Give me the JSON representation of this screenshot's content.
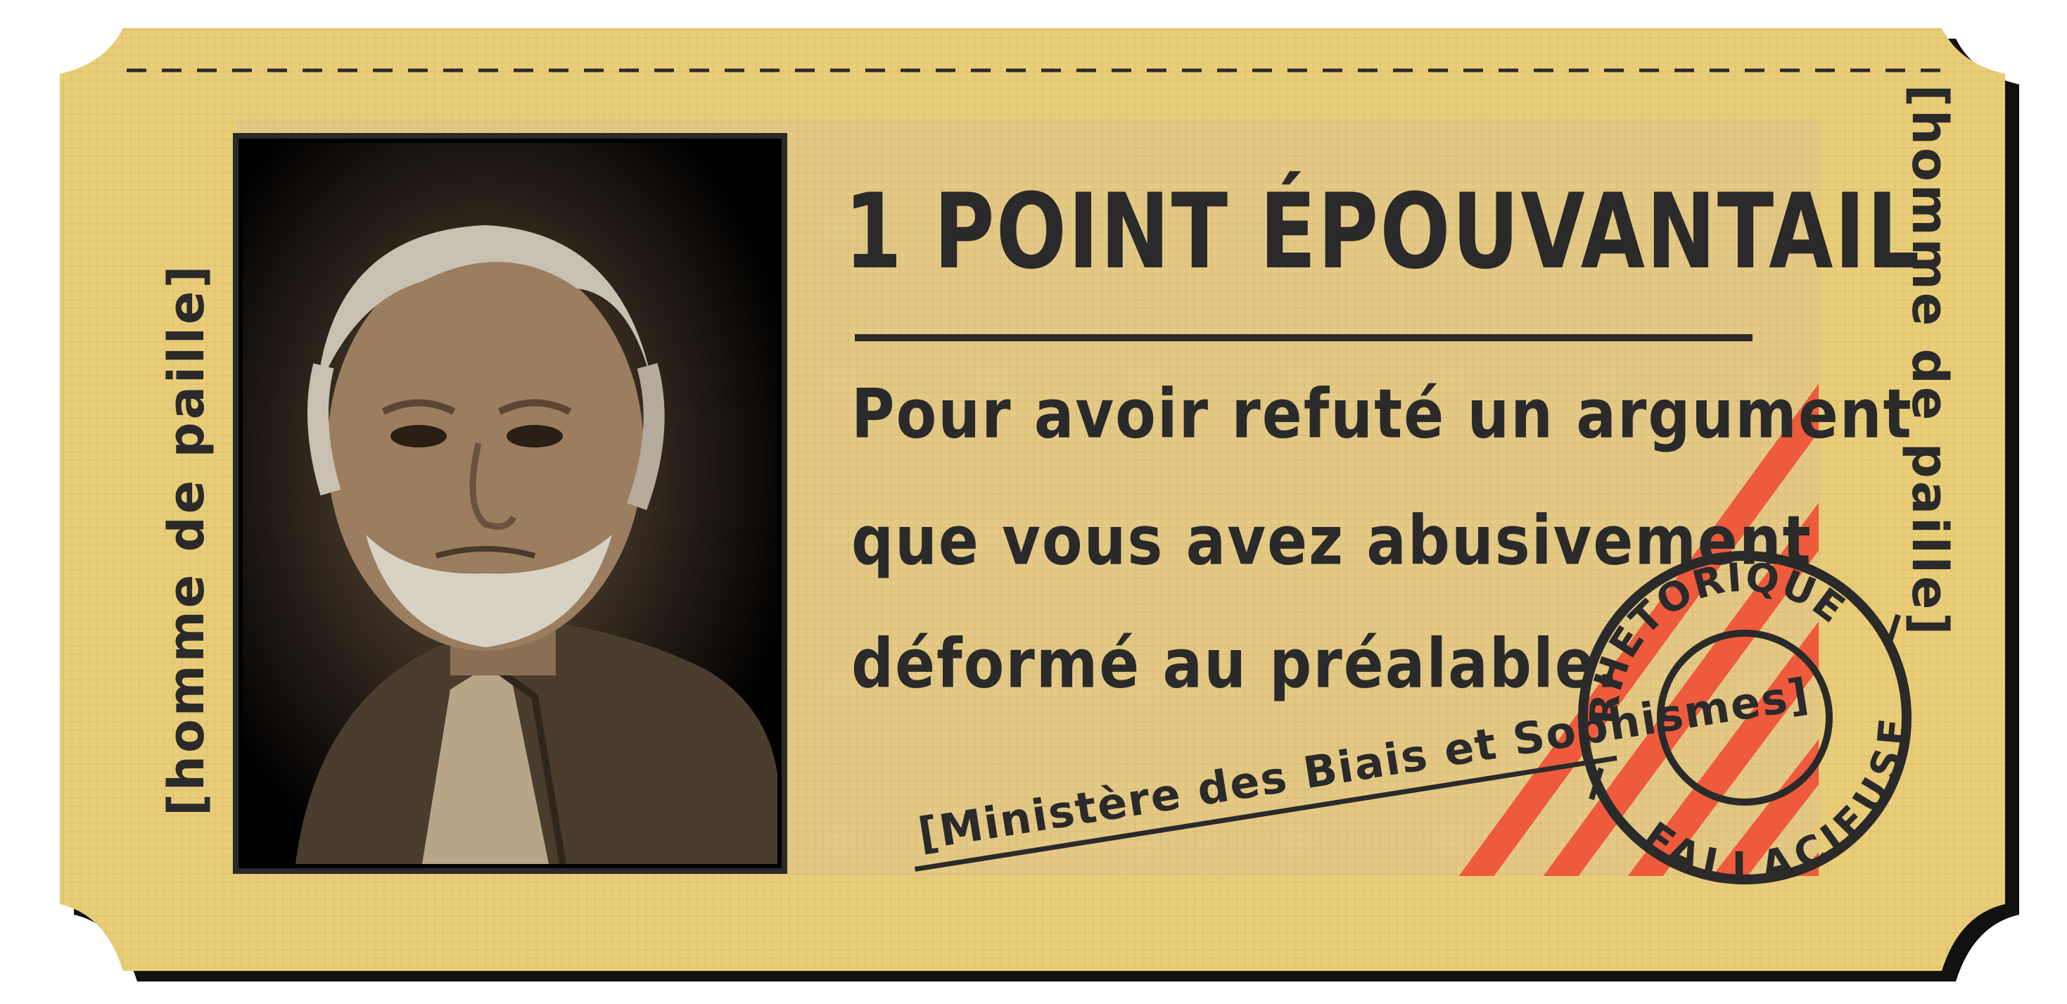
{
  "ticket": {
    "title": "1 POINT ÉPOUVANTAIL",
    "body_lines": [
      "Pour avoir refuté un argument",
      "que vous avez abusivement",
      "déformé au préalable."
    ],
    "side_left": "[homme de paille]",
    "side_right": "[homme de paille]",
    "ministry": "[Ministère des Biais et Sophismes]",
    "stamp_top": "RHÉTORIQUE",
    "stamp_bottom": "FALLACIEUSE",
    "colors": {
      "ticket_bg": "#e9cd78",
      "panel_bg": "#e3c985",
      "ink": "#2a2a2a",
      "stripe": "#ee5a3c",
      "shadow": "#111111"
    }
  }
}
